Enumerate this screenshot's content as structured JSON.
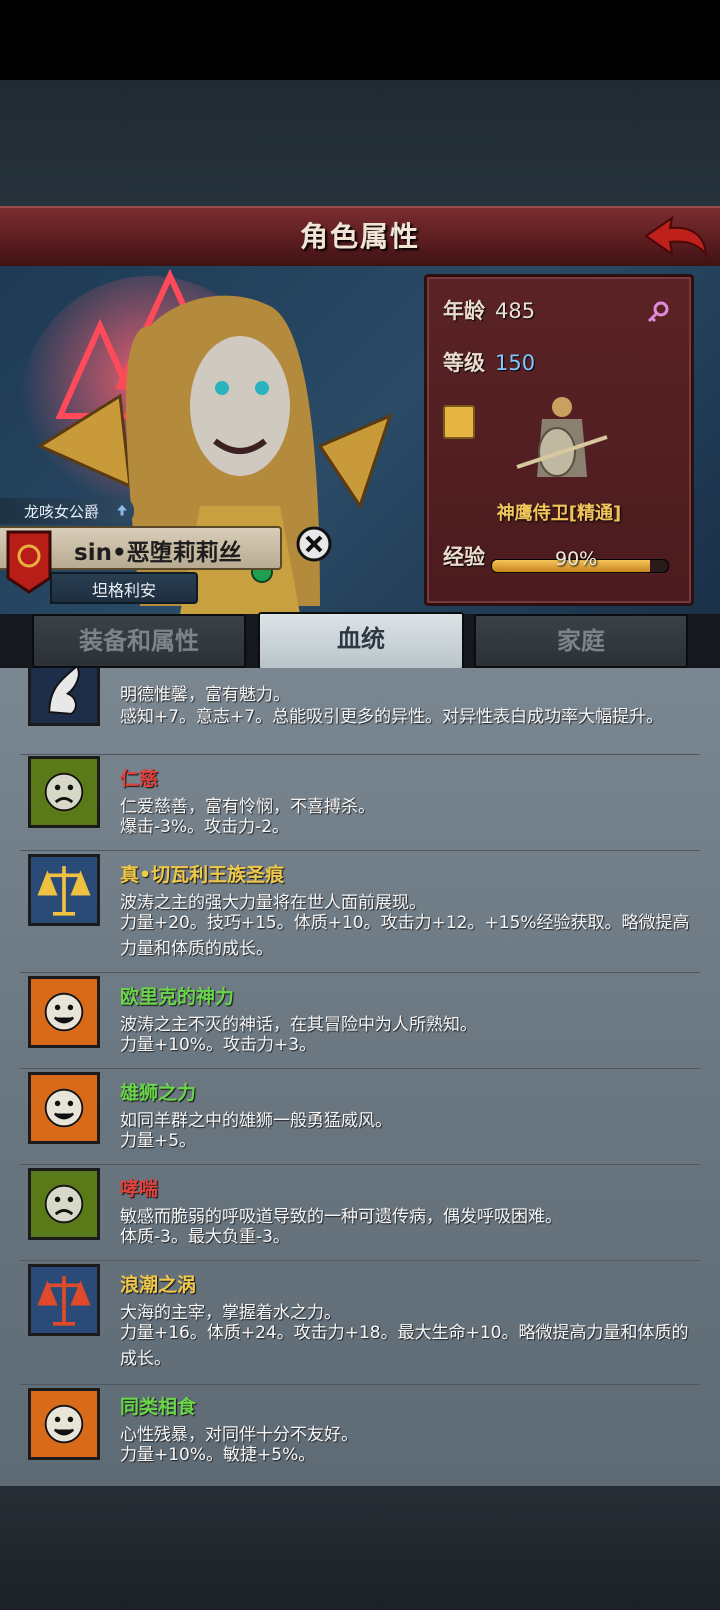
{
  "header": {
    "title": "角色属性"
  },
  "character": {
    "title_tag": "龙咳女公爵",
    "name": "sin•恶堕莉莉丝",
    "house": "坦格利安"
  },
  "stats": {
    "age_label": "年龄",
    "age_value": "485",
    "level_label": "等级",
    "level_value": "150",
    "unit_name": "神鹰侍卫[精通]",
    "exp_label": "经验",
    "exp_percent": "90%",
    "exp_fraction": 0.9
  },
  "tabs": [
    {
      "label": "装备和属性"
    },
    {
      "label": "血统"
    },
    {
      "label": "家庭"
    }
  ],
  "traits": [
    {
      "name": "",
      "desc": "明德惟馨，富有魅力。",
      "effect": "感知+7。意志+7。总能吸引更多的异性。对异性表白成功率大幅提升。",
      "icon": "arm-icon"
    },
    {
      "name": "仁慈",
      "desc": "仁爱慈善，富有怜悯，不喜搏杀。",
      "effect": "爆击-3%。攻击力-2。",
      "icon": "sad-face-icon"
    },
    {
      "name": "真•切瓦利王族圣痕",
      "desc": "波涛之主的强大力量将在世人面前展现。",
      "effect": "力量+20。技巧+15。体质+10。攻击力+12。+15%经验获取。略微提高力量和体质的成长。",
      "icon": "gold-scales-icon"
    },
    {
      "name": "欧里克的神力",
      "desc": "波涛之主不灭的神话，在其冒险中为人所熟知。",
      "effect": "力量+10%。攻击力+3。",
      "icon": "happy-face-icon"
    },
    {
      "name": "雄狮之力",
      "desc": "如同羊群之中的雄狮一般勇猛威风。",
      "effect": "力量+5。",
      "icon": "happy-face-icon"
    },
    {
      "name": "哮喘",
      "desc": "敏感而脆弱的呼吸道导致的一种可遗传病，偶发呼吸困难。",
      "effect": "体质-3。最大负重-3。",
      "icon": "sad-face-icon"
    },
    {
      "name": "浪潮之涡",
      "desc": "大海的主宰，掌握着水之力。",
      "effect": "力量+16。体质+24。攻击力+18。最大生命+10。略微提高力量和体质的成长。",
      "icon": "red-scales-icon"
    },
    {
      "name": "同类相食",
      "desc": "心性残暴，对同伴十分不友好。",
      "effect": "力量+10%。敏捷+5%。",
      "icon": "happy-face-icon"
    }
  ]
}
